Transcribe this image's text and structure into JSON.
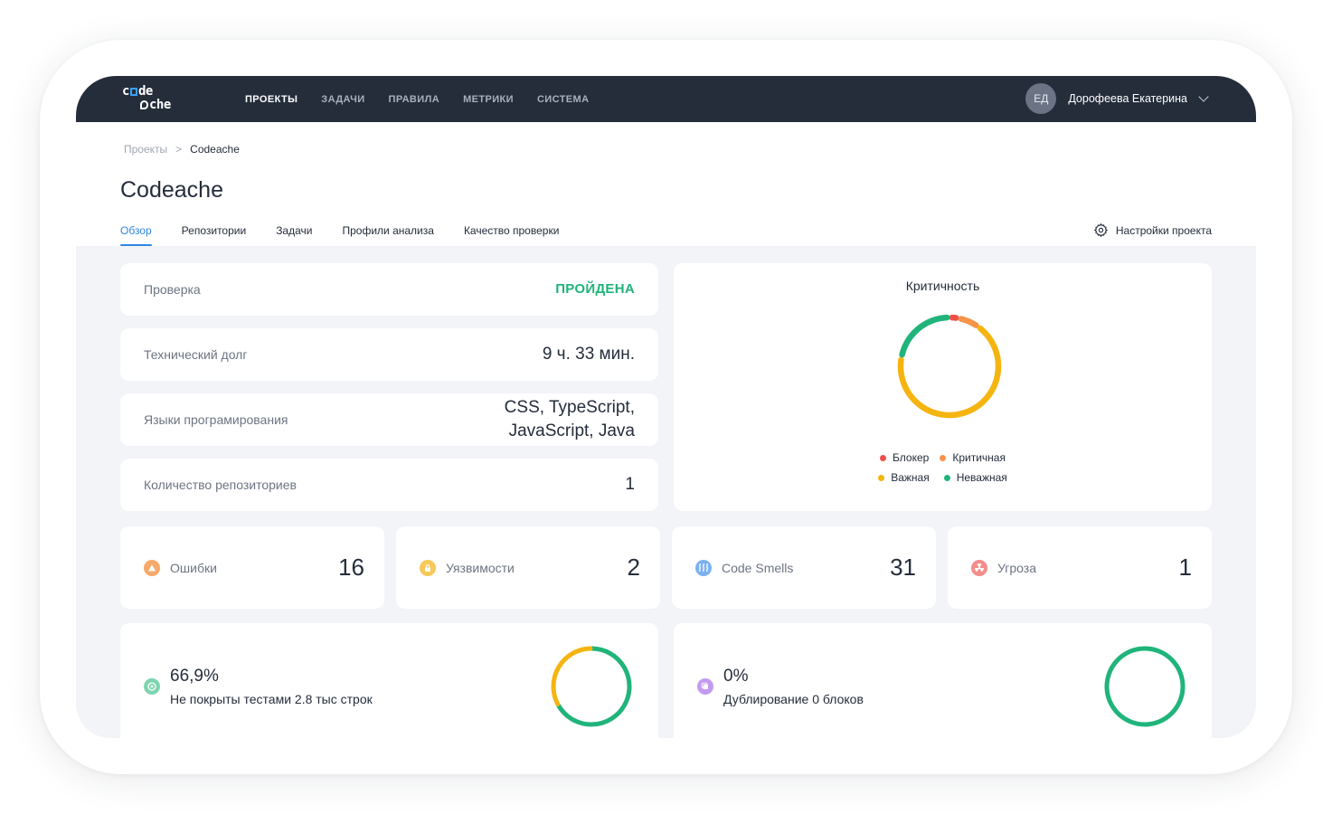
{
  "app": {
    "logo_top": [
      "c",
      "de"
    ],
    "logo_bottom": [
      "",
      "che"
    ],
    "nav": [
      {
        "label": "ПРОЕКТЫ",
        "active": true
      },
      {
        "label": "ЗАДАЧИ",
        "active": false
      },
      {
        "label": "ПРАВИЛА",
        "active": false
      },
      {
        "label": "МЕТРИКИ",
        "active": false
      },
      {
        "label": "СИСТЕМА",
        "active": false
      }
    ],
    "user": {
      "initials": "ЕД",
      "name": "Дорофеева Екатерина"
    }
  },
  "breadcrumb": {
    "parent": "Проекты",
    "separator": ">",
    "current": "Codeache"
  },
  "page": {
    "title": "Codeache",
    "tabs": [
      {
        "label": "Обзор",
        "active": true
      },
      {
        "label": "Репозитории",
        "active": false
      },
      {
        "label": "Задачи",
        "active": false
      },
      {
        "label": "Профили анализа",
        "active": false
      },
      {
        "label": "Качество проверки",
        "active": false
      }
    ],
    "settings_label": "Настройки проекта"
  },
  "overview": {
    "check": {
      "label": "Проверка",
      "value": "ПРОЙДЕНА"
    },
    "tech_debt": {
      "label": "Технический долг",
      "value": "9 ч. 33 мин."
    },
    "languages": {
      "label": "Языки програмирования",
      "value_line1": "CSS, TypeScript,",
      "value_line2": "JavaScript, Java"
    },
    "repo_count": {
      "label": "Количество репозиториев",
      "value": "1"
    }
  },
  "criticality": {
    "title": "Критичность",
    "legend": [
      {
        "label": "Блокер",
        "color": "#f0504a"
      },
      {
        "label": "Критичная",
        "color": "#f5944a"
      },
      {
        "label": "Важная",
        "color": "#f5b40f"
      },
      {
        "label": "Неважная",
        "color": "#20b47a"
      }
    ],
    "shares": {
      "blocker": 0.03,
      "critical": 0.07,
      "major": 0.68,
      "minor": 0.22
    }
  },
  "stats": [
    {
      "label": "Ошибки",
      "value": "16",
      "icon": "warning-icon",
      "color": "#f7a86a"
    },
    {
      "label": "Уязвимости",
      "value": "2",
      "icon": "lock-icon",
      "color": "#f7c95a"
    },
    {
      "label": "Code Smells",
      "value": "31",
      "icon": "smell-icon",
      "color": "#7ab0f0"
    },
    {
      "label": "Угроза",
      "value": "1",
      "icon": "radiation-icon",
      "color": "#f58c8c"
    }
  ],
  "coverage": {
    "value": "66,9%",
    "description": "Не покрыты тестами 2.8 тыс строк",
    "covered_fraction": 0.669,
    "color_covered": "#20b47a",
    "color_uncovered": "#f5b40f",
    "icon": "target-icon",
    "icon_color": "#7dd5b0"
  },
  "duplication": {
    "value": "0%",
    "description": "Дублирование 0 блоков",
    "duplicated_fraction": 0,
    "color": "#20b47a",
    "icon": "copy-icon",
    "icon_color": "#c49af0"
  }
}
